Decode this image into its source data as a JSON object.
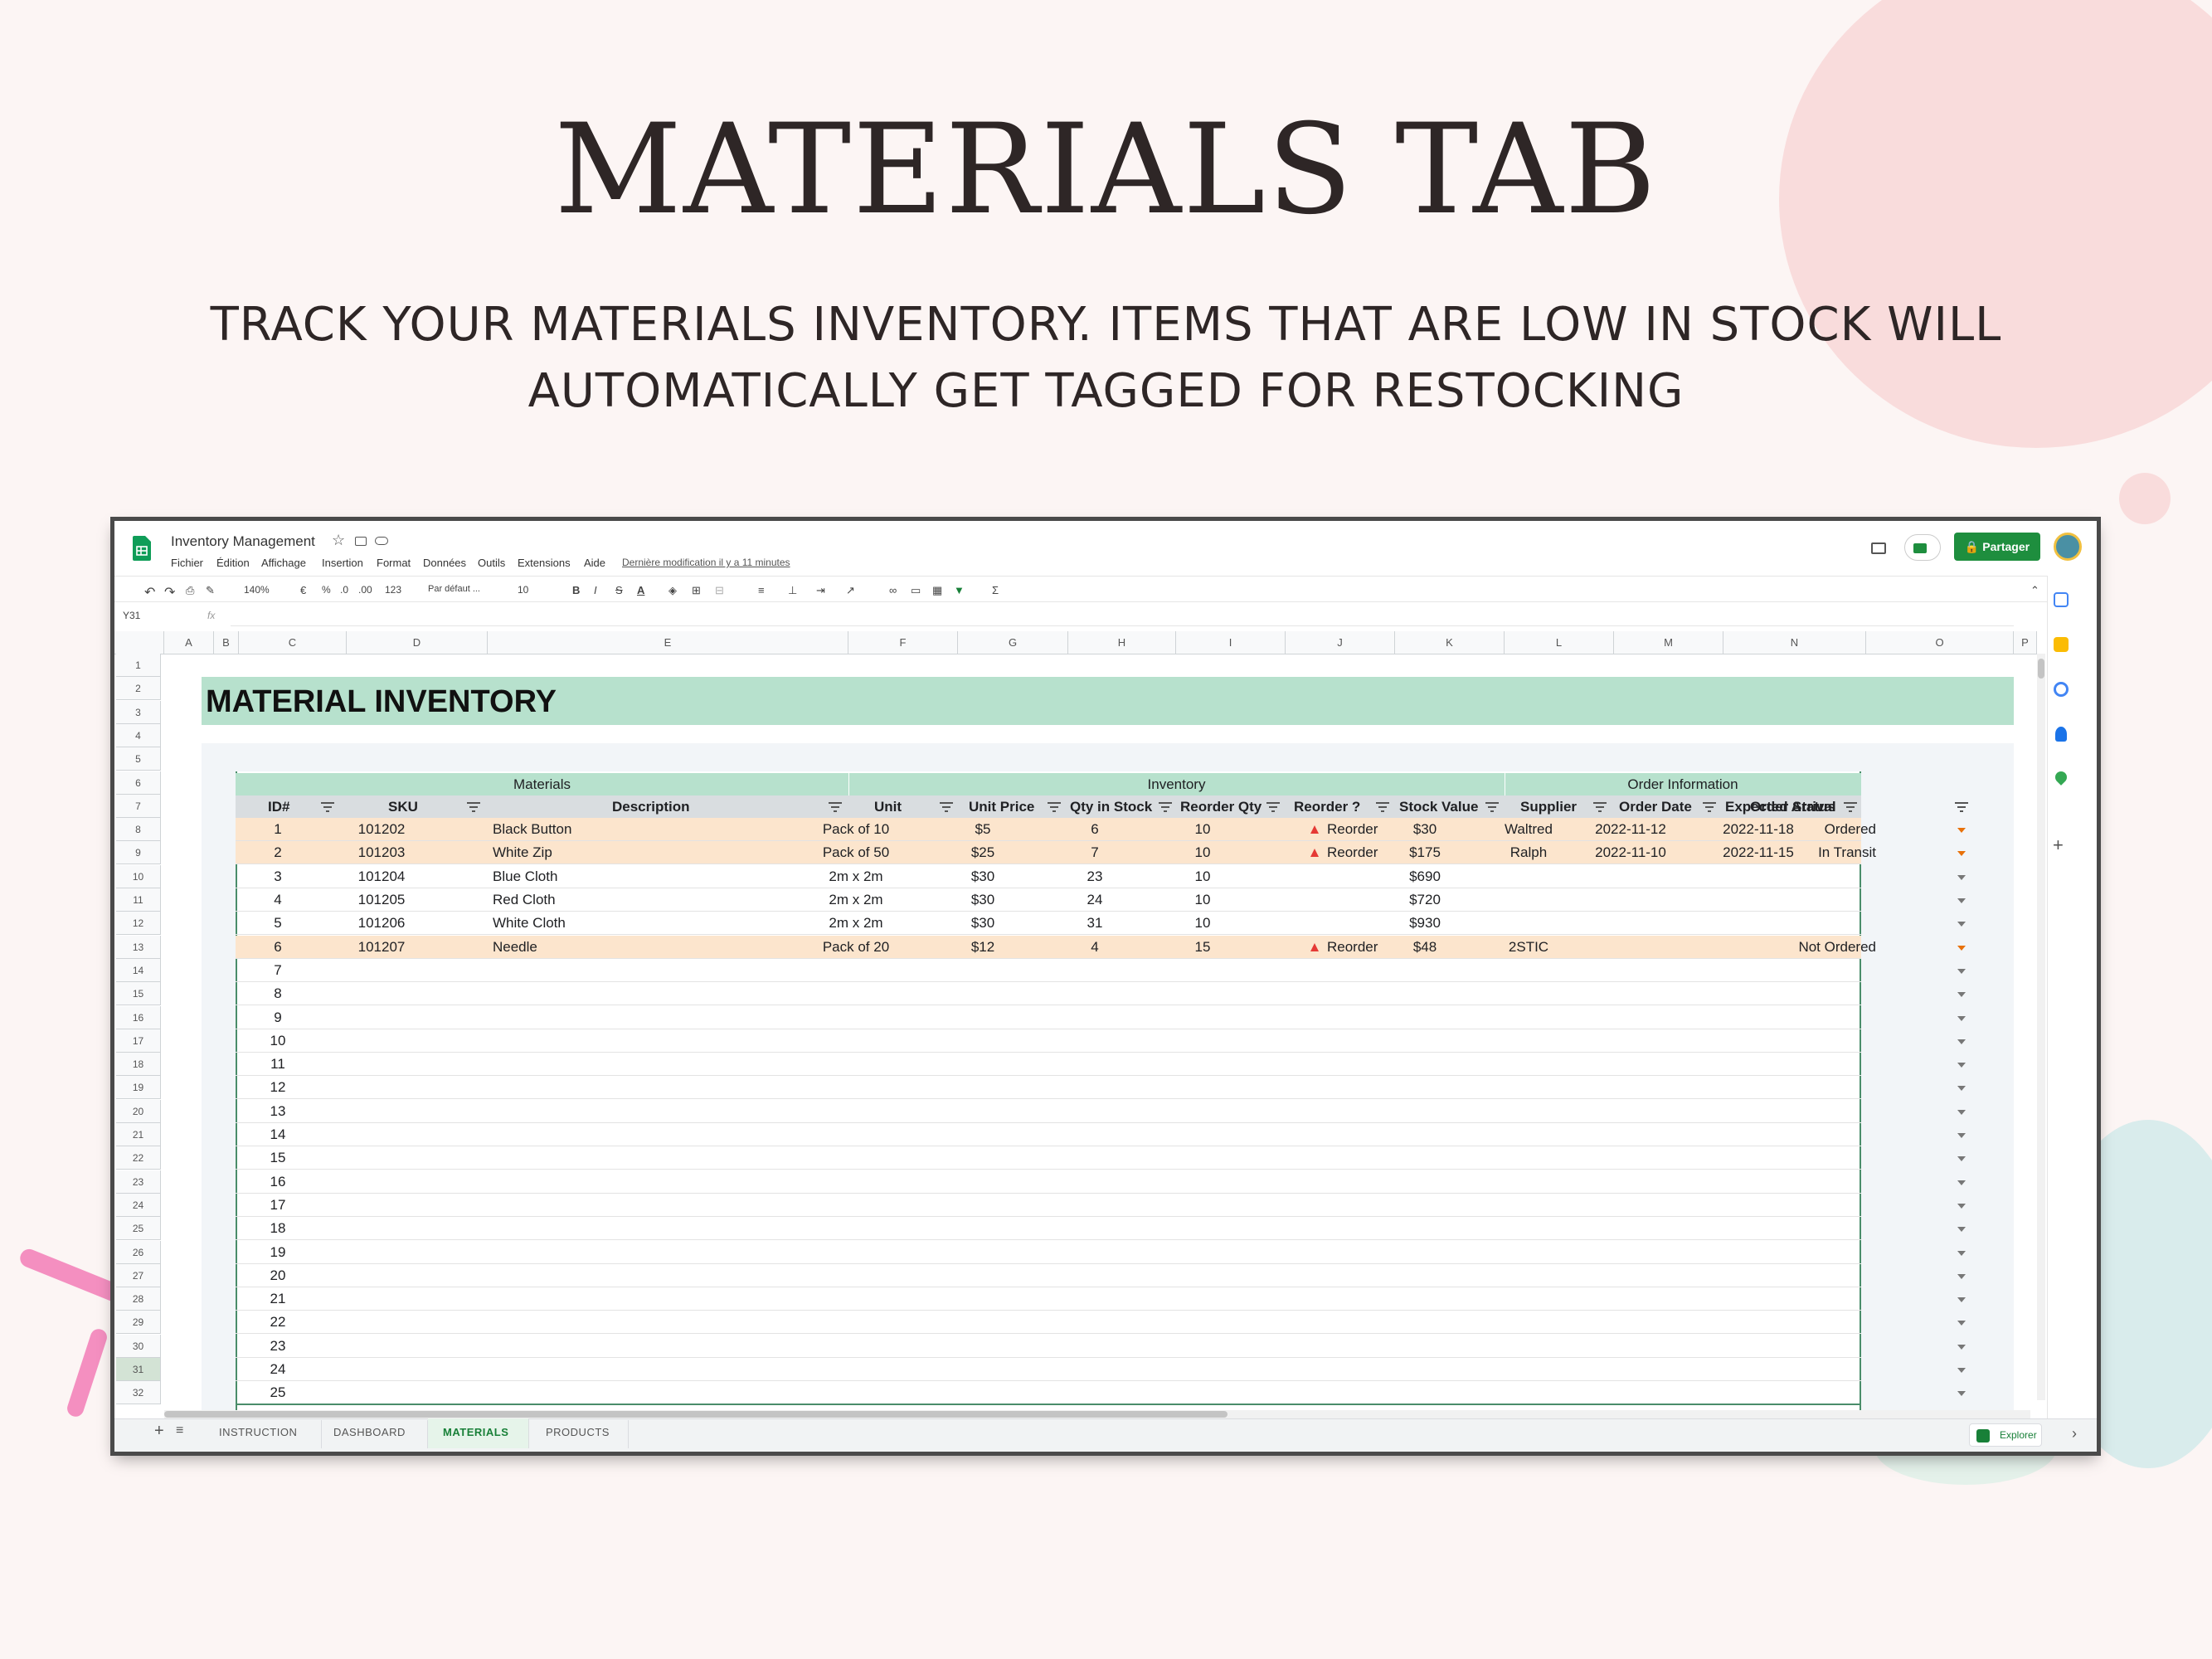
{
  "page": {
    "title": "MATERIALS TAB",
    "subtitle_line1": "TRACK YOUR MATERIALS INVENTORY. ITEMS THAT ARE LOW IN STOCK WILL",
    "subtitle_line2": "AUTOMATICALLY GET TAGGED FOR RESTOCKING"
  },
  "app": {
    "doc_title": "Inventory Management",
    "last_modified": "Dernière modification il y a 11 minutes",
    "share_label": "Partager",
    "explore_label": "Explorer",
    "cell_ref": "Y31",
    "fx": "fx"
  },
  "menu": [
    "Fichier",
    "Édition",
    "Affichage",
    "Insertion",
    "Format",
    "Données",
    "Outils",
    "Extensions",
    "Aide"
  ],
  "toolbar": {
    "zoom": "140%",
    "currency": "€",
    "percent": "%",
    "dec_less": ".0",
    "dec_more": ".00",
    "format_more": "123",
    "font": "Par défaut ...",
    "font_size": "10",
    "bold": "B",
    "italic": "I",
    "strike": "S",
    "text_color": "A",
    "sum": "Σ"
  },
  "columns": [
    "A",
    "B",
    "C",
    "D",
    "E",
    "F",
    "G",
    "H",
    "I",
    "J",
    "K",
    "L",
    "M",
    "N",
    "O",
    "P"
  ],
  "sheet": {
    "heading": "MATERIAL INVENTORY",
    "groups": {
      "materials": "Materials",
      "inventory": "Inventory",
      "order": "Order Information"
    },
    "headers": [
      "ID#",
      "SKU",
      "Description",
      "Unit",
      "Unit Price",
      "Qty in Stock",
      "Reorder Qty",
      "Reorder ?",
      "Stock Value",
      "Supplier",
      "Order Date",
      "Expected Arrival",
      "Order Status"
    ],
    "rows": [
      {
        "id": "1",
        "sku": "101202",
        "desc": "Black Button",
        "unit": "Pack of 10",
        "price": "$5",
        "qty": "6",
        "reorder_qty": "10",
        "reorder": "Reorder",
        "value": "$30",
        "supplier": "Waltred",
        "order_date": "2022-11-12",
        "arrival": "2022-11-18",
        "status": "Ordered"
      },
      {
        "id": "2",
        "sku": "101203",
        "desc": "White Zip",
        "unit": "Pack of 50",
        "price": "$25",
        "qty": "7",
        "reorder_qty": "10",
        "reorder": "Reorder",
        "value": "$175",
        "supplier": "Ralph",
        "order_date": "2022-11-10",
        "arrival": "2022-11-15",
        "status": "In Transit"
      },
      {
        "id": "3",
        "sku": "101204",
        "desc": "Blue Cloth",
        "unit": "2m x 2m",
        "price": "$30",
        "qty": "23",
        "reorder_qty": "10",
        "reorder": "",
        "value": "$690",
        "supplier": "",
        "order_date": "",
        "arrival": "",
        "status": ""
      },
      {
        "id": "4",
        "sku": "101205",
        "desc": "Red Cloth",
        "unit": "2m x 2m",
        "price": "$30",
        "qty": "24",
        "reorder_qty": "10",
        "reorder": "",
        "value": "$720",
        "supplier": "",
        "order_date": "",
        "arrival": "",
        "status": ""
      },
      {
        "id": "5",
        "sku": "101206",
        "desc": "White Cloth",
        "unit": "2m x 2m",
        "price": "$30",
        "qty": "31",
        "reorder_qty": "10",
        "reorder": "",
        "value": "$930",
        "supplier": "",
        "order_date": "",
        "arrival": "",
        "status": ""
      },
      {
        "id": "6",
        "sku": "101207",
        "desc": "Needle",
        "unit": "Pack of 20",
        "price": "$12",
        "qty": "4",
        "reorder_qty": "15",
        "reorder": "Reorder",
        "value": "$48",
        "supplier": "2STIC",
        "order_date": "",
        "arrival": "",
        "status": "Not Ordered"
      }
    ],
    "empty_ids": [
      "7",
      "8",
      "9",
      "10",
      "11",
      "12",
      "13",
      "14",
      "15",
      "16",
      "17",
      "18",
      "19",
      "20",
      "21",
      "22",
      "23",
      "24",
      "25"
    ]
  },
  "row_numbers": [
    "1",
    "2",
    "3",
    "4",
    "5",
    "6",
    "7",
    "8",
    "9",
    "10",
    "11",
    "12",
    "13",
    "14",
    "15",
    "16",
    "17",
    "18",
    "19",
    "20",
    "21",
    "22",
    "23",
    "24",
    "25",
    "26",
    "27",
    "28",
    "29",
    "30",
    "31",
    "32"
  ],
  "tabs": [
    "INSTRUCTION",
    "DASHBOARD",
    "MATERIALS",
    "PRODUCTS"
  ],
  "colors": {
    "accent_green": "#b7e1cd",
    "reorder_highlight": "#fce5cd",
    "sheets_green": "#188038",
    "share_green": "#1e8e3e"
  }
}
